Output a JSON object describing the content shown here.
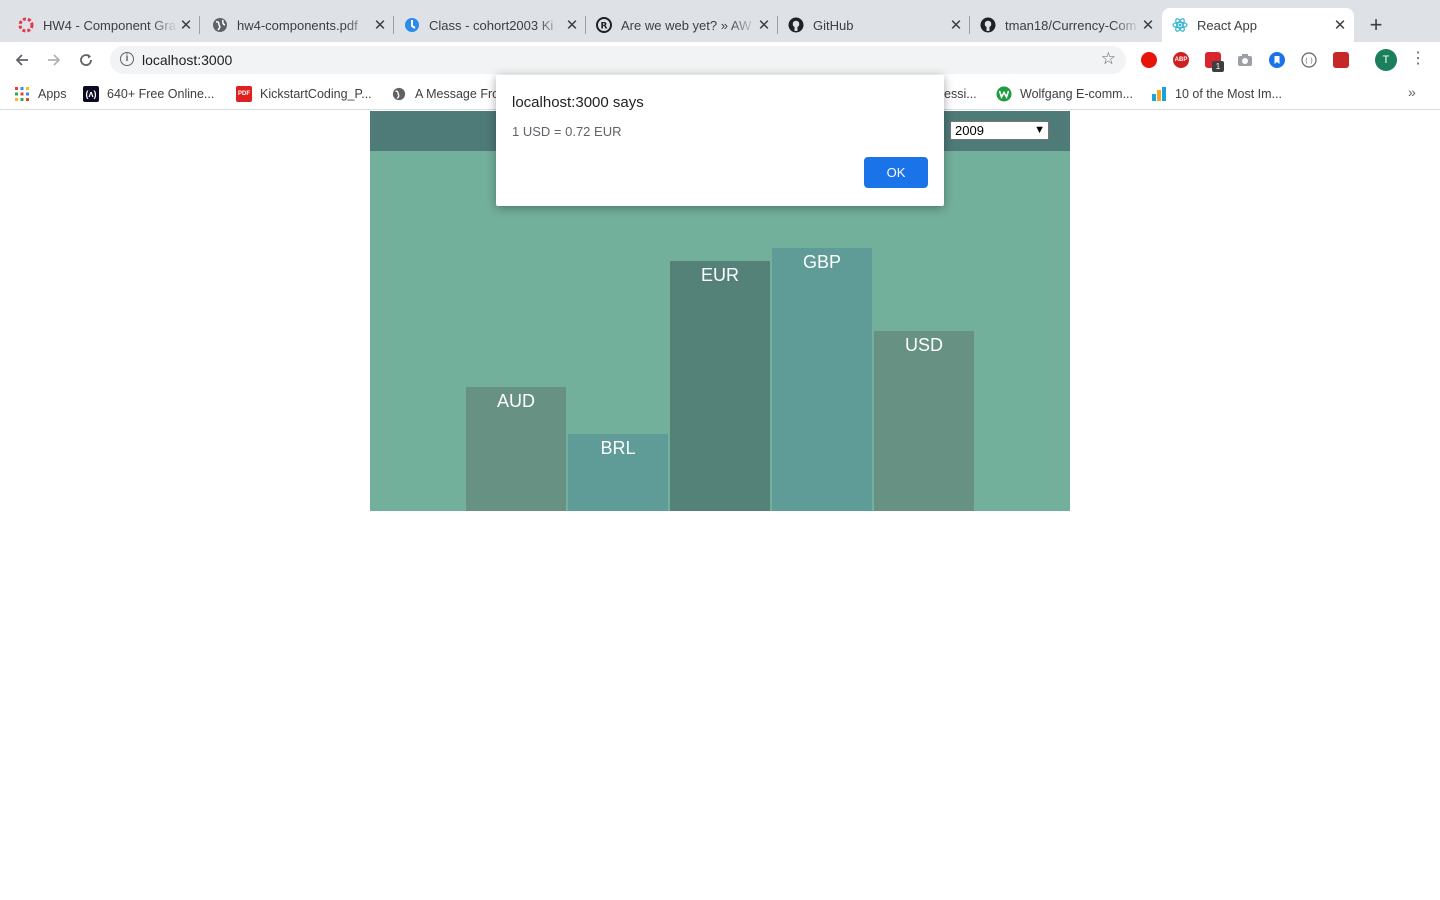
{
  "browser": {
    "tabs": [
      {
        "title": "HW4 - Component Gra",
        "icon": "kickstart-icon",
        "active": false
      },
      {
        "title": "hw4-components.pdf",
        "icon": "globe-icon",
        "active": false
      },
      {
        "title": "Class - cohort2003 Ki",
        "icon": "kickstart-blue-icon",
        "active": false
      },
      {
        "title": "Are we web yet? » AW",
        "icon": "rust-icon",
        "active": false
      },
      {
        "title": "GitHub",
        "icon": "github-icon",
        "active": false
      },
      {
        "title": "tman18/Currency-Com",
        "icon": "github-icon",
        "active": false
      },
      {
        "title": "React App",
        "icon": "react-icon",
        "active": true
      }
    ],
    "url": "localhost:3000",
    "profile_initial": "T",
    "ext_badge": "1",
    "bookmarks": [
      {
        "label": "Apps",
        "icon": "apps-grid-icon"
      },
      {
        "label": "640+ Free Online...",
        "icon": "freecodecamp-icon"
      },
      {
        "label": "KickstartCoding_P...",
        "icon": "pdf-icon"
      },
      {
        "label": "A Message Fro",
        "icon": "globe-icon"
      },
      {
        "label": "essi...",
        "icon": "none"
      },
      {
        "label": "Wolfgang E-comm...",
        "icon": "wolfgang-icon"
      },
      {
        "label": "10 of the Most Im...",
        "icon": "chart-icon"
      }
    ]
  },
  "app": {
    "year": "2009",
    "accent_header": "#4e7a78",
    "accent_bg": "#73b09c"
  },
  "chart_data": {
    "type": "bar",
    "categories": [
      "AUD",
      "BRL",
      "EUR",
      "GBP",
      "USD"
    ],
    "values": [
      124,
      77,
      250,
      263,
      180
    ],
    "colors": [
      "#679183",
      "#5f9b97",
      "#548279",
      "#5f9b97",
      "#679183"
    ]
  },
  "dialog": {
    "title": "localhost:3000 says",
    "message": "1 USD = 0.72 EUR",
    "ok_label": "OK"
  }
}
